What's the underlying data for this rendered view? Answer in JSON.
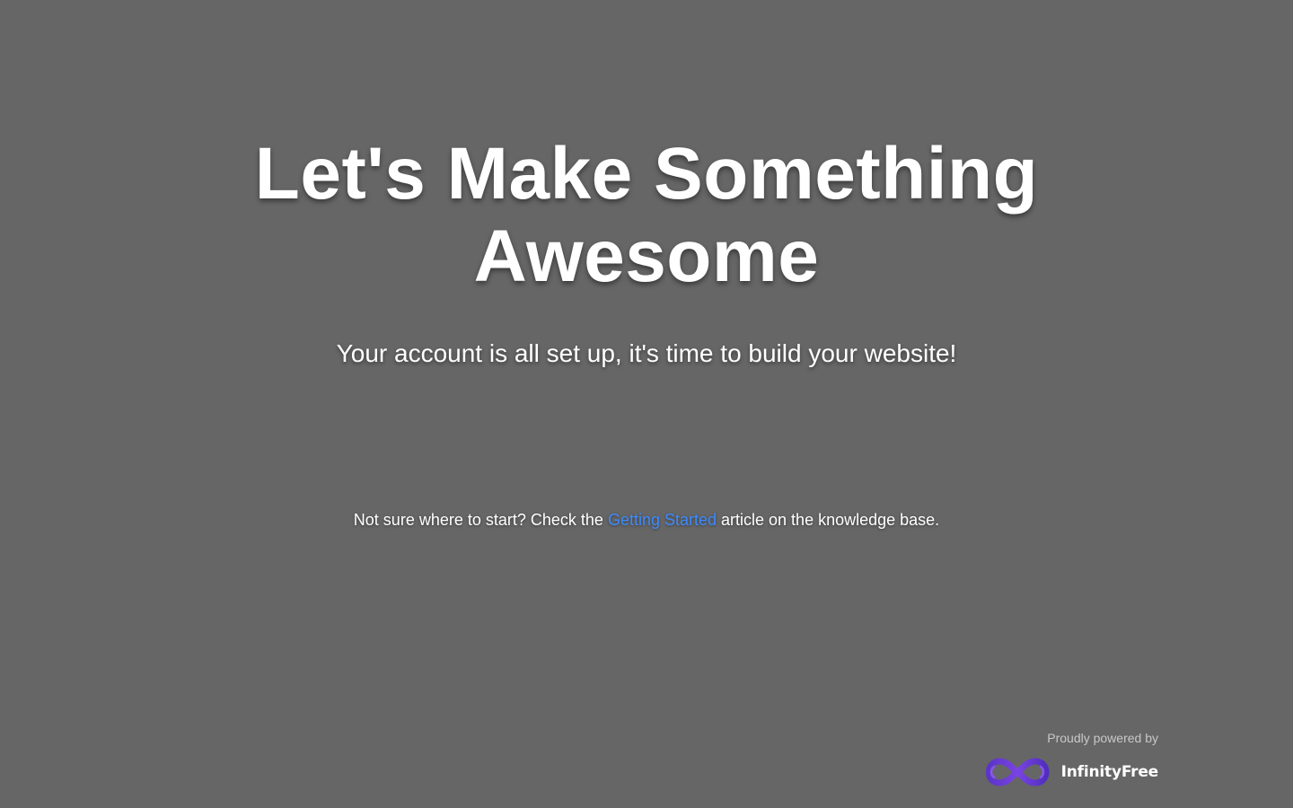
{
  "hero": {
    "title": "Let's Make Something Awesome",
    "subtitle": "Your account is all set up, it's time to build your website!"
  },
  "help": {
    "prefix": "Not sure where to start? Check the ",
    "link_label": "Getting Started",
    "suffix": " article on the knowledge base."
  },
  "footer": {
    "powered_text": "Proudly powered by",
    "brand_name": "InfinityFree",
    "brand_icon": "infinity-logo-icon"
  },
  "colors": {
    "background": "#666666",
    "text": "#ffffff",
    "link": "#3d8bfd",
    "brand_purple": "#6b3fd6"
  }
}
